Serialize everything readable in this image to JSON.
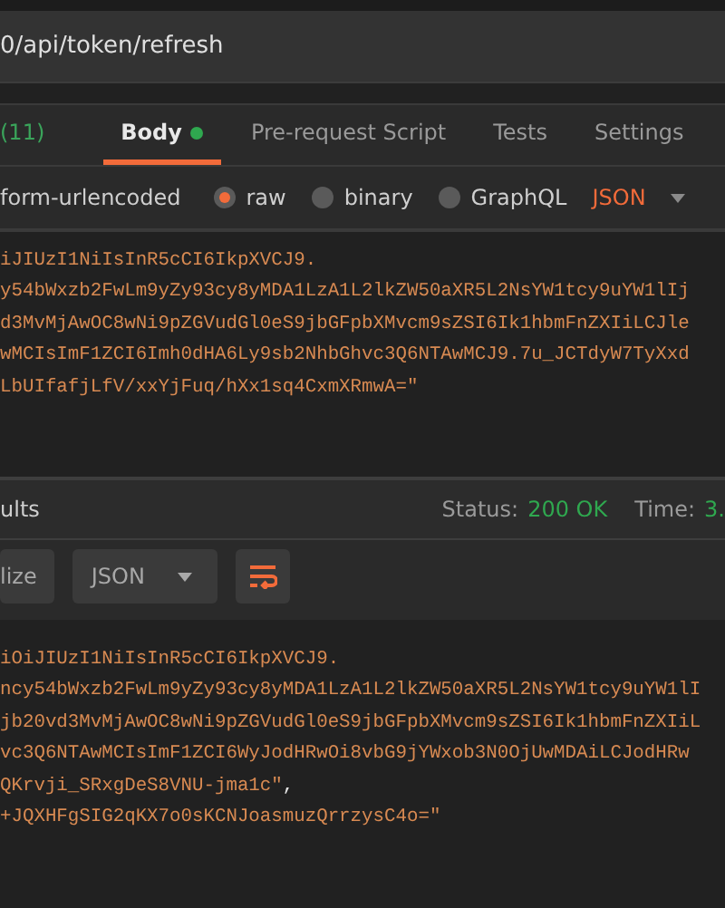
{
  "url": "0/api/token/refresh",
  "request_tabs": [
    {
      "label": "(11)",
      "kind": "count",
      "selected": false,
      "dot": false
    },
    {
      "label": "Body",
      "kind": "tab",
      "selected": true,
      "dot": true
    },
    {
      "label": "Pre-request Script",
      "kind": "tab",
      "selected": false,
      "dot": false
    },
    {
      "label": "Tests",
      "kind": "tab",
      "selected": false,
      "dot": false
    },
    {
      "label": "Settings",
      "kind": "tab",
      "selected": false,
      "dot": false
    }
  ],
  "body_types": [
    {
      "label": "form-urlencoded",
      "kind": "text",
      "selected": false
    },
    {
      "label": "raw",
      "kind": "radio",
      "selected": true
    },
    {
      "label": "binary",
      "kind": "radio",
      "selected": false
    },
    {
      "label": "GraphQL",
      "kind": "radio",
      "selected": false
    }
  ],
  "format_dropdown": "JSON",
  "request_lines": [
    {
      "text": "iJIUzI1NiIsInR5cCI6IkpXVCJ9."
    },
    {
      "text": "y54bWxzb2FwLm9yZy93cy8yMDA1LzA1L2lkZW50aXR5L2NsYW1tcy9uYW1lIj"
    },
    {
      "text": "d3MvMjAwOC8wNi9pZGVudGl0eS9jbGFpbXMvcm9sZSI6Ik1hbmFnZXIiLCJle"
    },
    {
      "text": "wMCIsImF1ZCI6Imh0dHA6Ly9sb2NhbGhvc3Q6NTAwMCJ9.7u_JCTdyW7TyXxd"
    },
    {
      "text": "LbUIfafjLfV/xxYjFuq/hXx1sq4CxmXRmwA=\""
    }
  ],
  "response": {
    "title": "ults",
    "status_label": "Status:",
    "status": "200 OK",
    "time_label": "Time:",
    "time": "3.",
    "view_button": "lize",
    "format_dropdown": "JSON",
    "lines": [
      {
        "text": "iOiJIUzI1NiIsInR5cCI6IkpXVCJ9."
      },
      {
        "text": "ncy54bWxzb2FwLm9yZy93cy8yMDA1LzA1L2lkZW50aXR5L2NsYW1tcy9uYW1lI"
      },
      {
        "text": "jb20vd3MvMjAwOC8wNi9pZGVudGl0eS9jbGFpbXMvcm9sZSI6Ik1hbmFnZXIiL"
      },
      {
        "text": "vc3Q6NTAwMCIsImF1ZCI6WyJodHRwOi8vbG9jYWxob3N0OjUwMDAiLCJodHRw"
      },
      {
        "text": "QKrvji_SRxgDeS8VNU-jma1c\"",
        "punct": ","
      },
      {
        "text": "+JQXHFgSIG2qKX7o0sKCNJoasmuzQrrzysC4o=\""
      }
    ]
  }
}
